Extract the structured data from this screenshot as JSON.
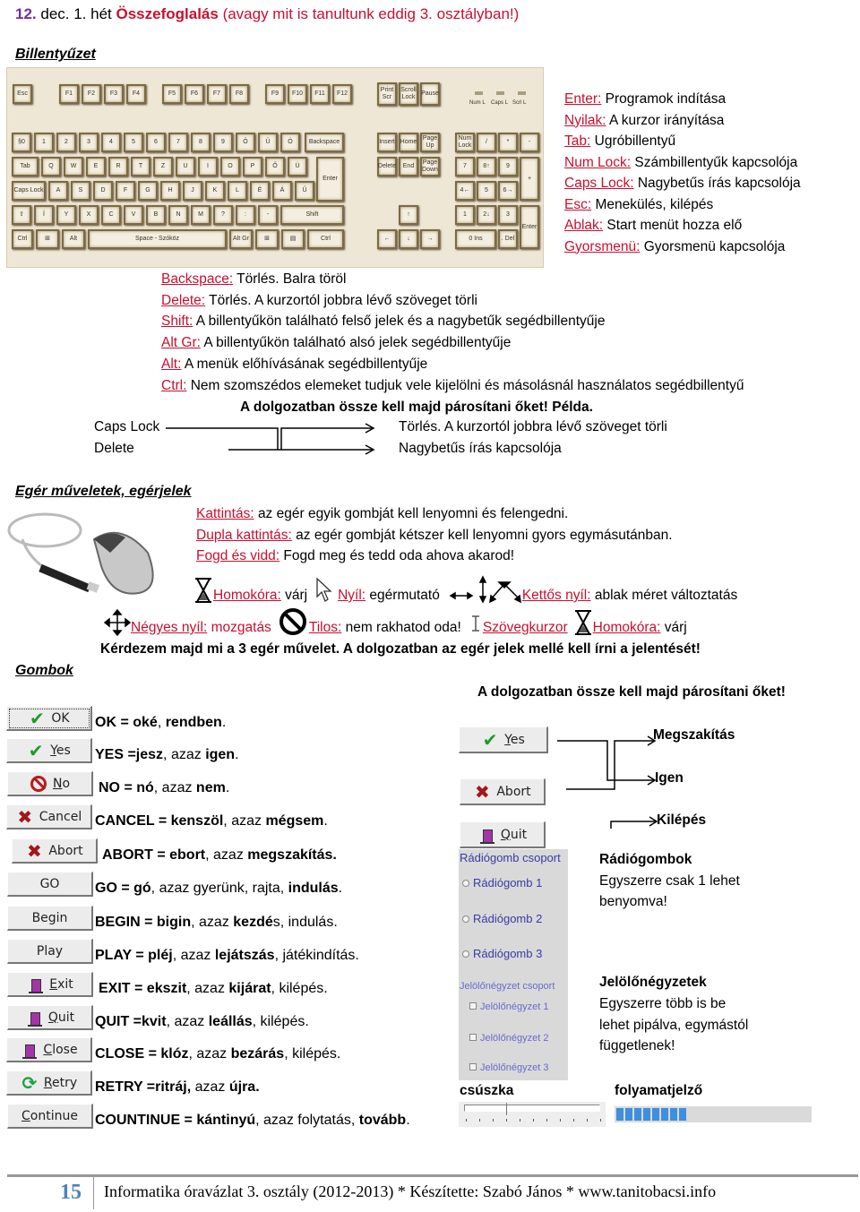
{
  "header": {
    "lesson_number": "12.",
    "date": "dec. 1. hét",
    "title_bold": "Összefoglalás",
    "title_rest": "(avagy mit is tanultunk eddig 3. osztályban!)"
  },
  "keyboard_section": {
    "heading": "Billentyűzet",
    "image_keys": {
      "esc": "Esc",
      "f_keys": [
        "F1",
        "F2",
        "F3",
        "F4",
        "F5",
        "F6",
        "F7",
        "F8",
        "F9",
        "F10",
        "F11",
        "F12"
      ],
      "print": "Print Scr",
      "scroll": "Scroll Lock",
      "pause": "Pause",
      "leds": [
        "Num L",
        "Caps L",
        "Scrl L"
      ],
      "backspace": "Backspace",
      "tab": "Tab",
      "caps": "Caps Lock",
      "enter": "Enter",
      "shift": "Shift",
      "ctrl": "Ctrl",
      "alt": "Alt",
      "space": "Space - Szóköz",
      "altgr": "Alt Gr",
      "insert": "Insert",
      "home": "Home",
      "pgup": "Page Up",
      "delete": "Delete",
      "end": "End",
      "pgdn": "Page Down",
      "numlock": "Num Lock"
    },
    "right_definitions": [
      {
        "key": "Enter:",
        "text": "Programok indítása"
      },
      {
        "key": "Nyilak:",
        "text": "A kurzor irányítása"
      },
      {
        "key": "Tab:",
        "text": "Ugróbillentyű"
      },
      {
        "key": "Num Lock:",
        "text": "Számbillentyűk kapcsolója"
      },
      {
        "key": "Caps Lock:",
        "text": "Nagybetűs írás kapcsolója"
      },
      {
        "key": "Esc:",
        "text": "Menekülés, kilépés"
      },
      {
        "key": "Ablak:",
        "text": "Start menüt hozza elő"
      },
      {
        "key": "Gyorsmenü:",
        "text": "Gyorsmenü kapcsolója"
      }
    ],
    "lower_definitions": [
      {
        "key": "Backspace:",
        "text": "Törlés. Balra töröl"
      },
      {
        "key": "Delete:",
        "text": "Törlés. A kurzortól jobbra lévő szöveget törli"
      },
      {
        "key": "Shift:",
        "text": "A billentyűkön található felső jelek és a nagybetűk segédbillentyűje"
      },
      {
        "key": "Alt Gr:",
        "text": "A billentyűkön található alsó jelek segédbillentyűje"
      },
      {
        "key": "Alt:",
        "text": "A menük előhívásának segédbillentyűje"
      },
      {
        "key": "Ctrl:",
        "text": "Nem szomszédos elemeket tudjuk vele kijelölni és másolásnál használatos segédbillentyű"
      }
    ],
    "pairing_note": "A dolgozatban össze kell majd párosítani őket! Példa.",
    "example": {
      "left": [
        "Caps Lock",
        "Delete"
      ],
      "right": [
        "Törlés. A kurzortól jobbra lévő szöveget törli",
        "Nagybetűs írás kapcsolója"
      ]
    }
  },
  "mouse_section": {
    "heading": "Egér műveletek, egérjelek",
    "operations": [
      {
        "key": "Kattintás:",
        "text": "az egér egyik gombját kell lenyomni és felengedni."
      },
      {
        "key": "Dupla kattintás:",
        "text": "az egér gombját kétszer kell lenyomni gyors egymásutánban."
      },
      {
        "key": "Fogd és vidd:",
        "text": "Fogd meg és tedd oda ahova akarod!"
      }
    ],
    "cursors_row1": [
      {
        "icon": "hourglass-icon",
        "key": "Homokóra:",
        "text": "várj"
      },
      {
        "icon": "arrow-pointer-icon",
        "key": "Nyíl:",
        "text": "egérmutató"
      },
      {
        "icon": "double-arrow-icon",
        "key": "Kettős nyíl:",
        "text": "ablak méret változtatás"
      }
    ],
    "cursors_row2": [
      {
        "icon": "move-icon",
        "key": "Négyes nyíl:",
        "text": "mozgatás"
      },
      {
        "icon": "forbidden-icon",
        "key": "Tilos:",
        "text": "nem rakhatod oda!"
      },
      {
        "icon": "text-cursor-icon",
        "key": "Szövegkurzor",
        "text": ""
      },
      {
        "icon": "hourglass-icon",
        "key": "Homokóra:",
        "text": "várj"
      }
    ],
    "note": "Kérdezem majd mi a 3 egér művelet. A dolgozatban az egér jelek mellé kell írni a jelentését!"
  },
  "buttons_section": {
    "heading": "Gombok",
    "buttons": [
      {
        "label": "OK",
        "icon": "check",
        "desc_parts": [
          [
            "OK = oké",
            true
          ],
          [
            ", ",
            false
          ],
          [
            "rendben",
            true
          ],
          [
            ".",
            false
          ]
        ]
      },
      {
        "label": "Yes",
        "icon": "check",
        "desc_parts": [
          [
            "YES =jesz",
            true
          ],
          [
            ", azaz ",
            false
          ],
          [
            "igen",
            true
          ],
          [
            ".",
            false
          ]
        ]
      },
      {
        "label": "No",
        "icon": "no",
        "desc_parts": [
          [
            "NO = nó",
            true
          ],
          [
            ", azaz ",
            false
          ],
          [
            "nem",
            true
          ],
          [
            ".",
            false
          ]
        ]
      },
      {
        "label": "Cancel",
        "icon": "x",
        "desc_parts": [
          [
            "CANCEL = kenszöl",
            true
          ],
          [
            ", azaz ",
            false
          ],
          [
            "mégsem",
            true
          ],
          [
            ".",
            false
          ]
        ]
      },
      {
        "label": "Abort",
        "icon": "x",
        "desc_parts": [
          [
            "ABORT = ebort",
            true
          ],
          [
            ", azaz ",
            false
          ],
          [
            "megszakítás.",
            true
          ]
        ]
      },
      {
        "label": "GO",
        "icon": "",
        "desc_parts": [
          [
            "GO = gó",
            true
          ],
          [
            ", azaz gyerünk, rajta, ",
            false
          ],
          [
            "indulás",
            true
          ],
          [
            ".",
            false
          ]
        ]
      },
      {
        "label": "Begin",
        "icon": "",
        "desc_parts": [
          [
            "BEGIN = bigin",
            true
          ],
          [
            ", azaz ",
            false
          ],
          [
            "kezdé",
            true
          ],
          [
            "s, indulás.",
            false
          ]
        ]
      },
      {
        "label": "Play",
        "icon": "",
        "desc_parts": [
          [
            "PLAY = pléj",
            true
          ],
          [
            ", azaz ",
            false
          ],
          [
            "lejátszás",
            true
          ],
          [
            ", játékindítás.",
            false
          ]
        ]
      },
      {
        "label": "Exit",
        "icon": "door",
        "desc_parts": [
          [
            "EXIT = ekszit",
            true
          ],
          [
            ", azaz ",
            false
          ],
          [
            "kijárat",
            true
          ],
          [
            ", kilépés.",
            false
          ]
        ]
      },
      {
        "label": "Quit",
        "icon": "door",
        "desc_parts": [
          [
            "QUIT =kvit",
            true
          ],
          [
            ", azaz ",
            false
          ],
          [
            "leállás",
            true
          ],
          [
            ", kilépés.",
            false
          ]
        ]
      },
      {
        "label": "Close",
        "icon": "door",
        "desc_parts": [
          [
            "CLOSE = klóz",
            true
          ],
          [
            ", azaz ",
            false
          ],
          [
            "bezárás",
            true
          ],
          [
            ", kilépés.",
            false
          ]
        ]
      },
      {
        "label": "Retry",
        "icon": "retry",
        "desc_parts": [
          [
            "RETRY =ritráj,",
            true
          ],
          [
            " azaz ",
            false
          ],
          [
            "újra.",
            true
          ]
        ]
      },
      {
        "label": "Continue",
        "icon": "",
        "desc_parts": [
          [
            "COUNTINUE = kántinyú",
            true
          ],
          [
            ", azaz folytatás, ",
            false
          ],
          [
            "tovább",
            true
          ],
          [
            ".",
            false
          ]
        ]
      }
    ],
    "pairing_note": "A dolgozatban össze kell majd párosítani őket!",
    "pairing_buttons": [
      "Yes",
      "Abort",
      "Quit"
    ],
    "pairing_targets": [
      "Megszakítás",
      "Igen",
      "Kilépés"
    ]
  },
  "controls_section": {
    "radio_group_title": "Rádiógomb csoport",
    "radios": [
      "Rádiógomb 1",
      "Rádiógomb 2",
      "Rádiógomb 3"
    ],
    "checkbox_group_title": "Jelölőnégyzet csoport",
    "checkboxes": [
      "Jelölőnégyzet 1",
      "Jelölőnégyzet 2",
      "Jelölőnégyzet 3"
    ],
    "radio_heading": "Rádiógombok",
    "radio_desc": [
      "Egyszerre csak 1 lehet",
      "benyomva!"
    ],
    "checkbox_heading": "Jelölőnégyzetek",
    "checkbox_desc": [
      "Egyszerre több is be",
      "lehet pipálva, egymástól",
      "függetlenek!"
    ],
    "slider_label": "csúszka",
    "slider_value": 0.3,
    "slider_ticks": 11,
    "progress_label": "folyamatjelző",
    "progress_value": 0.35
  },
  "footer": {
    "page_number": "15",
    "text": "Informatika óravázlat 3. osztály (2012-2013) * Készítette: Szabó János * www.tanitobacsi.info"
  },
  "colors": {
    "label_red": "#c8102e",
    "number_purple": "#7030a0",
    "footer_blue": "#4f81bd"
  }
}
